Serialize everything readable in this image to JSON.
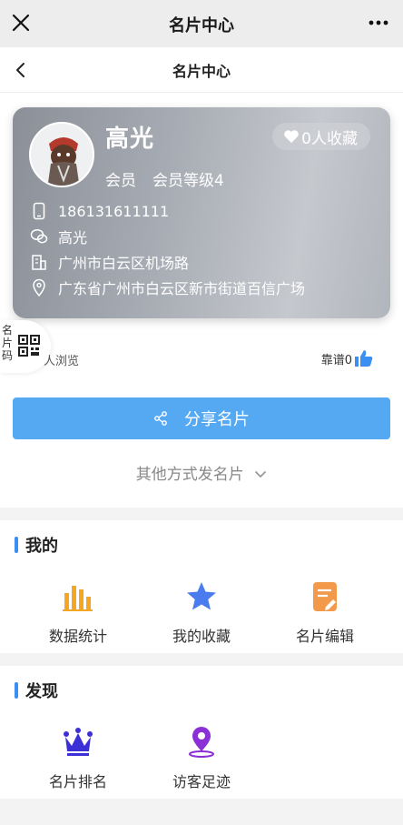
{
  "window": {
    "title": "名片中心"
  },
  "nav": {
    "title": "名片中心"
  },
  "card": {
    "name": "高光",
    "favorites": "0人收藏",
    "role": "会员",
    "level": "会员等级4",
    "phone": "186131611111",
    "wechat": "高光",
    "company_address": "广州市白云区机场路",
    "location": "广东省广州市白云区新市街道百信广场"
  },
  "qr_tab": {
    "label": "名片码"
  },
  "stats": {
    "views": "人浏览",
    "likes": "靠谱0"
  },
  "actions": {
    "share": "分享名片",
    "other_ways": "其他方式发名片"
  },
  "mine": {
    "title": "我的",
    "items": [
      {
        "label": "数据统计",
        "icon": "bar-chart-icon"
      },
      {
        "label": "我的收藏",
        "icon": "star-icon"
      },
      {
        "label": "名片编辑",
        "icon": "edit-document-icon"
      }
    ]
  },
  "discover": {
    "title": "发现",
    "items": [
      {
        "label": "名片排名",
        "icon": "crown-icon"
      },
      {
        "label": "访客足迹",
        "icon": "location-pin-icon"
      }
    ]
  },
  "colors": {
    "accent": "#55a9f3",
    "section_bar": "#3b8ff3",
    "chart_orange": "#f5a623",
    "star_blue": "#4a7cf0",
    "edit_orange": "#f2994a",
    "crown_purple": "#3b2fd6",
    "pin_purple": "#8b2fd6"
  }
}
